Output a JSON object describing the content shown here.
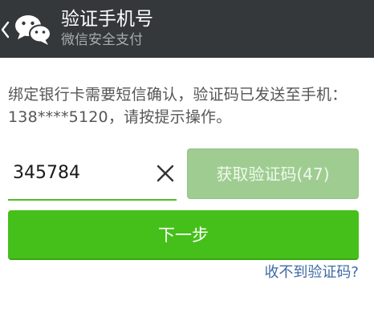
{
  "header": {
    "title": "验证手机号",
    "subtitle": "微信安全支付",
    "back_icon": "back-chevron-icon",
    "logo_icon": "wechat-logo-icon",
    "background": "#34383b"
  },
  "main": {
    "instruction": "绑定银行卡需要短信确认，验证码已发送至手机：138****5120，请按提示操作。",
    "code_input": {
      "value": "345784",
      "placeholder": ""
    },
    "clear_icon": "clear-x-icon",
    "get_code_button": "获取验证码(47)",
    "next_button": "下一步",
    "help_link": "收不到验证码?"
  },
  "colors": {
    "accent": "#45c01a",
    "disabled_button": "#9fcd91",
    "link": "#3f6aa3",
    "input_underline": "#4ebc2b"
  }
}
